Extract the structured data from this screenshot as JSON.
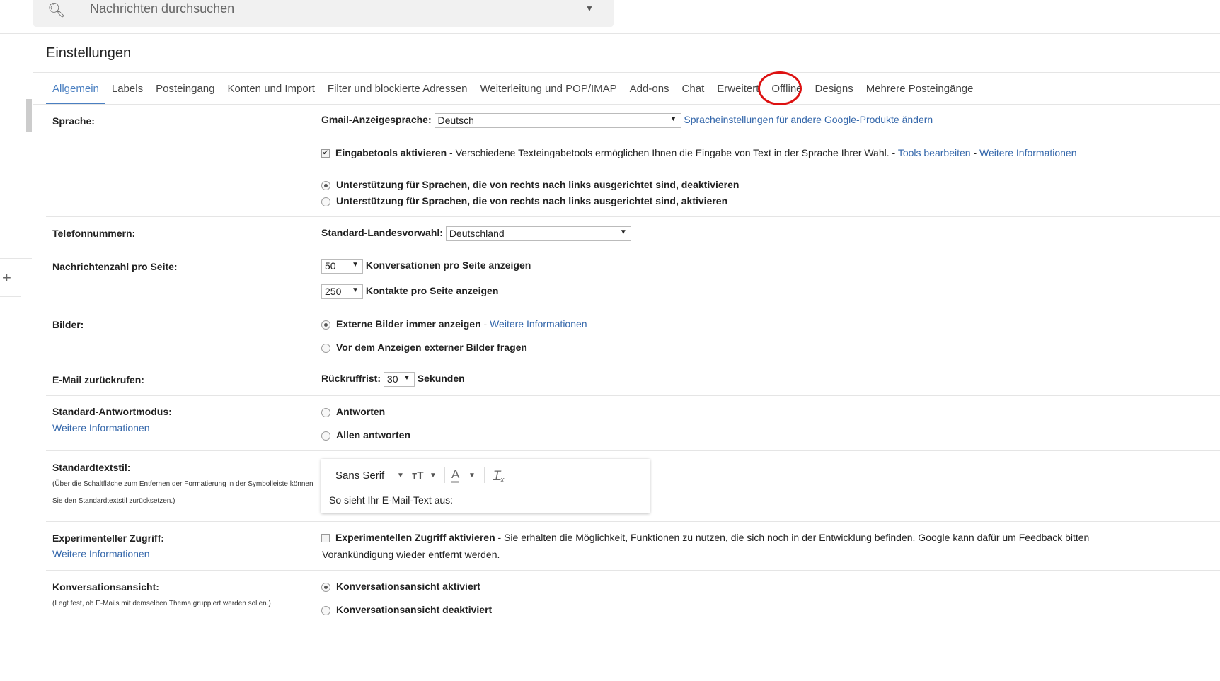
{
  "search": {
    "placeholder": "Nachrichten durchsuchen",
    "icon": "search-icon"
  },
  "title": "Einstellungen",
  "tabs": [
    {
      "label": "Allgemein",
      "active": true
    },
    {
      "label": "Labels"
    },
    {
      "label": "Posteingang"
    },
    {
      "label": "Konten und Import"
    },
    {
      "label": "Filter und blockierte Adressen"
    },
    {
      "label": "Weiterleitung und POP/IMAP"
    },
    {
      "label": "Add-ons"
    },
    {
      "label": "Chat"
    },
    {
      "label": "Erweitert"
    },
    {
      "label": "Offline"
    },
    {
      "label": "Designs"
    },
    {
      "label": "Mehrere Posteingänge"
    }
  ],
  "highlight_color": "#dd1111",
  "accent": "#4a7fc1",
  "sprache": {
    "label": "Sprache:",
    "display_label": "Gmail-Anzeigesprache:",
    "display_value": "Deutsch",
    "other_link": "Spracheinstellungen für andere Google-Produkte ändern",
    "input_tools_bold": "Eingabetools aktivieren",
    "input_tools_text": " - Verschiedene Texteingabetools ermöglichen Ihnen die Eingabe von Text in der Sprache Ihrer Wahl. - ",
    "tools_link": "Tools bearbeiten",
    "sep": " - ",
    "more_link": "Weitere Informationen",
    "rtl_off": "Unterstützung für Sprachen, die von rechts nach links ausgerichtet sind, deaktivieren",
    "rtl_on": "Unterstützung für Sprachen, die von rechts nach links ausgerichtet sind, aktivieren"
  },
  "telefon": {
    "label": "Telefonnummern:",
    "field_label": "Standard-Landesvorwahl:",
    "value": "Deutschland"
  },
  "nachrichten": {
    "label": "Nachrichtenzahl pro Seite:",
    "conv_value": "50",
    "conv_text": "Konversationen pro Seite anzeigen",
    "contacts_value": "250",
    "contacts_text": "Kontakte pro Seite anzeigen"
  },
  "bilder": {
    "label": "Bilder:",
    "always": "Externe Bilder immer anzeigen",
    "sep": " - ",
    "link": "Weitere Informationen",
    "ask": "Vor dem Anzeigen externer Bilder fragen"
  },
  "recall": {
    "label": "E-Mail zurückrufen:",
    "field_label": "Rückruffrist:",
    "value": "30",
    "unit": "Sekunden"
  },
  "reply": {
    "label": "Standard-Antwortmodus:",
    "link": "Weitere Informationen",
    "opt1": "Antworten",
    "opt2": "Allen antworten"
  },
  "textstyle": {
    "label": "Standardtextstil:",
    "hint1": "(Über die Schaltfläche zum Entfernen der Formatierung in der Symbolleiste können",
    "hint2": "Sie den Standardtextstil zurücksetzen.)",
    "font": "Sans Serif",
    "preview": "So sieht Ihr E-Mail-Text aus:"
  },
  "experimental": {
    "label": "Experimenteller Zugriff:",
    "link": "Weitere Informationen",
    "bold": "Experimentellen Zugriff aktivieren",
    "text": " - Sie erhalten die Möglichkeit, Funktionen zu nutzen, die sich noch in der Entwicklung befinden. Google kann dafür um Feedback bitten",
    "text2": "Vorankündigung wieder entfernt werden."
  },
  "conversation": {
    "label": "Konversationsansicht:",
    "hint": "(Legt fest, ob E-Mails mit demselben Thema gruppiert werden sollen.)",
    "on": "Konversationsansicht aktiviert",
    "off": "Konversationsansicht deaktiviert"
  }
}
